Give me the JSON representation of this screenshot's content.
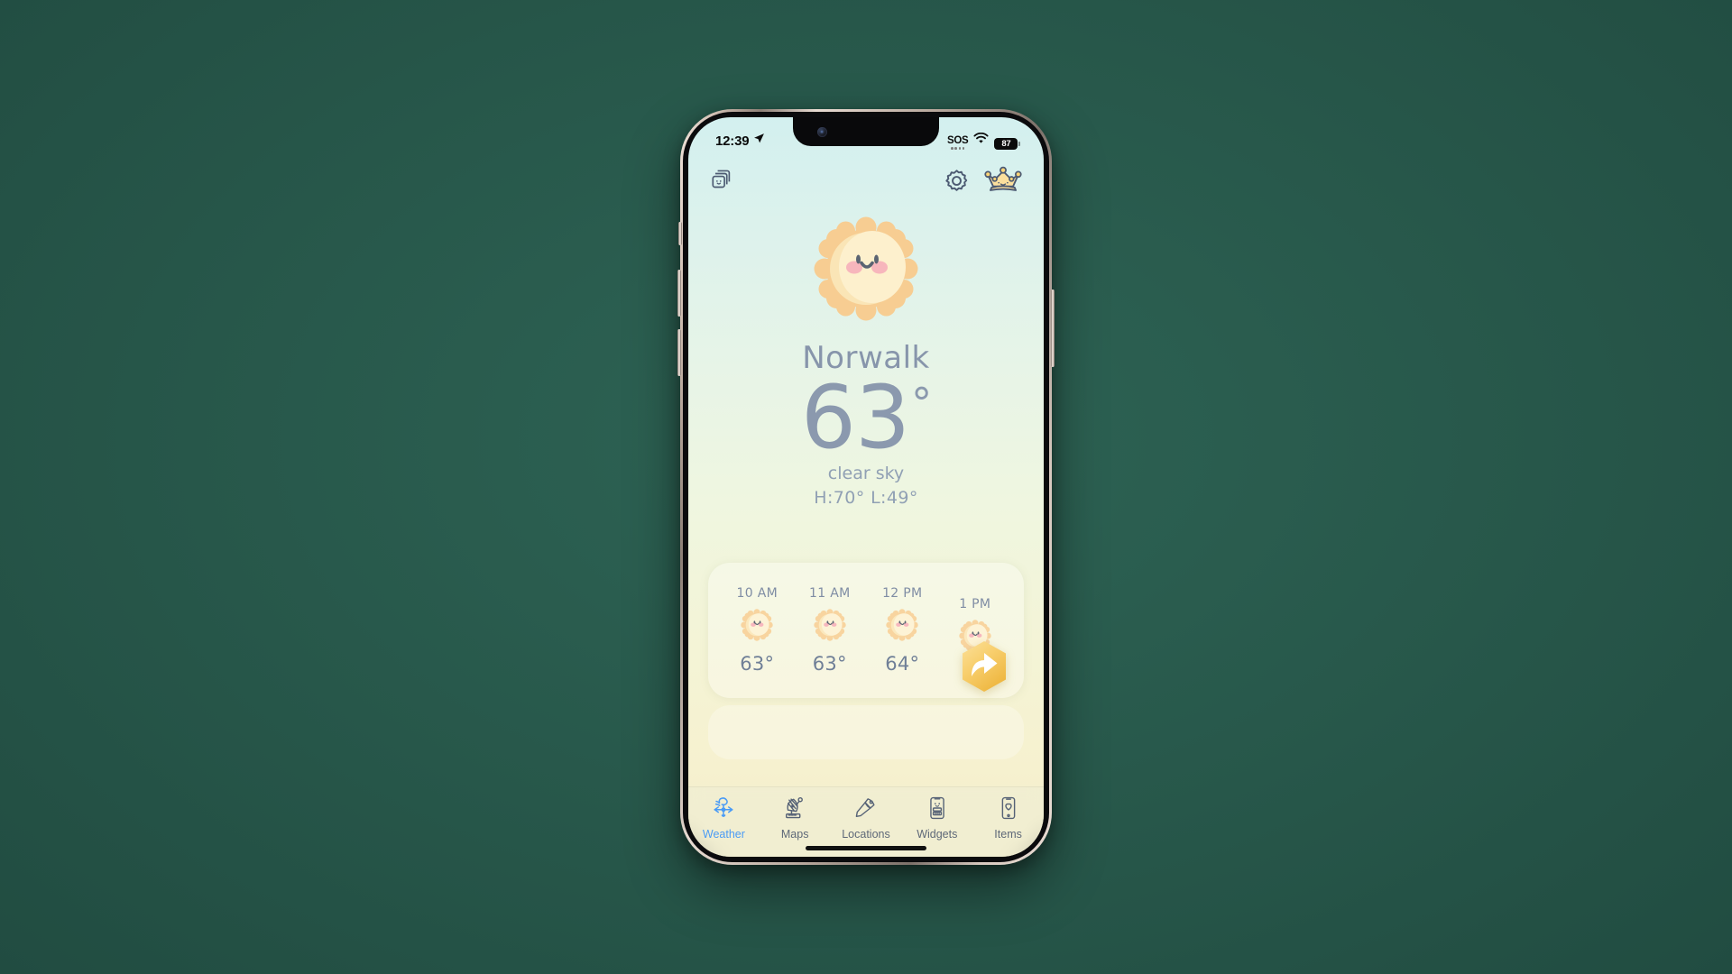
{
  "device": {
    "type": "iphone",
    "frame_color": "#cbb9ad"
  },
  "status_bar": {
    "time": "12:39",
    "location_icon": "location-arrow-icon",
    "sos_label": "SOS",
    "wifi_icon": "wifi-icon",
    "battery_level": "87"
  },
  "app_header": {
    "cards_icon": "cards-stack-icon",
    "settings_icon": "gear-icon",
    "premium_icon": "crown-icon"
  },
  "weather": {
    "hero_icon": "sun-face-icon",
    "city": "Norwalk",
    "temperature": "63",
    "degree": "°",
    "condition": "clear sky",
    "high_low": "H:70°  L:49°"
  },
  "hourly": {
    "items": [
      {
        "time": "10 AM",
        "icon": "sun-face-icon",
        "temp": "63°"
      },
      {
        "time": "11 AM",
        "icon": "sun-face-icon",
        "temp": "63°"
      },
      {
        "time": "12 PM",
        "icon": "sun-face-icon",
        "temp": "64°"
      },
      {
        "time": "1 PM",
        "icon": "sun-face-icon",
        "temp": ""
      }
    ],
    "share_icon": "share-arrow-icon"
  },
  "tabbar": {
    "tabs": [
      {
        "label": "Weather",
        "icon": "weathervane-icon",
        "active": true
      },
      {
        "label": "Maps",
        "icon": "satellite-dish-icon",
        "active": false
      },
      {
        "label": "Locations",
        "icon": "pushpin-icon",
        "active": false
      },
      {
        "label": "Widgets",
        "icon": "phone-widget-icon",
        "active": false
      },
      {
        "label": "Items",
        "icon": "phone-heart-icon",
        "active": false
      }
    ]
  },
  "colors": {
    "backdrop_green": "#27574a",
    "accent_blue": "#4a9bf5",
    "text_slate": "#8795ab",
    "sun_orange": "#f6c98a",
    "sun_face": "#fbe7bd",
    "share_yellow": "#f5c council"
  }
}
